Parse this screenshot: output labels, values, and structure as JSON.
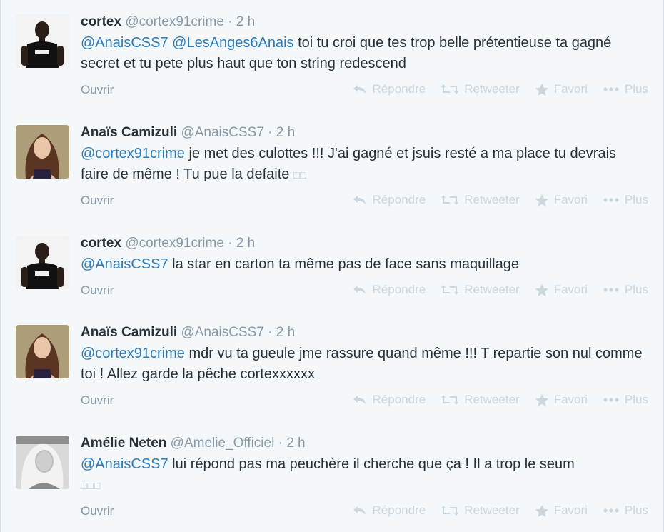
{
  "tweets": [
    {
      "name": "cortex",
      "handle": "@cortex91crime",
      "separator": "·",
      "time": "2 h",
      "mentions": [
        "@AnaisCSS7",
        "@LesAnges6Anais"
      ],
      "text": "toi tu croi que tes trop belle prétentieuse ta gagné secret et tu pete plus haut que ton string redescend",
      "glyph": "",
      "avatar": "man-in-black-shirt"
    },
    {
      "name": "Anaïs Camizuli",
      "handle": "@AnaisCSS7",
      "separator": "·",
      "time": "2 h",
      "mentions": [
        "@cortex91crime"
      ],
      "text": "je met des culottes !!! J'ai gagné et jsuis resté a ma place tu devrais faire de même ! Tu pue la defaite",
      "glyph": "□□",
      "avatar": "woman-brown-hair"
    },
    {
      "name": "cortex",
      "handle": "@cortex91crime",
      "separator": "·",
      "time": "2 h",
      "mentions": [
        "@AnaisCSS7"
      ],
      "text": "la star en carton ta même pas de face sans maquillage",
      "glyph": "",
      "avatar": "man-in-black-shirt"
    },
    {
      "name": "Anaïs Camizuli",
      "handle": "@AnaisCSS7",
      "separator": "·",
      "time": "2 h",
      "mentions": [
        "@cortex91crime"
      ],
      "text": "mdr vu ta gueule jme rassure quand même !!! T repartie son nul comme toi ! Allez garde la pêche cortexxxxxx",
      "glyph": "",
      "avatar": "woman-brown-hair"
    },
    {
      "name": "Amélie Neten",
      "handle": "@Amelie_Officiel",
      "separator": "·",
      "time": "2 h",
      "mentions": [
        "@AnaisCSS7"
      ],
      "text": "lui répond pas ma peuchère il cherche que ça ! Il a trop le seum",
      "glyph": "□□□",
      "avatar": "woman-blonde-bw"
    }
  ],
  "actions": {
    "open": "Ouvrir",
    "reply": "Répondre",
    "retweet": "Retweeter",
    "favorite": "Favori",
    "more": "Plus"
  },
  "colors": {
    "background": "#f5f8fa",
    "mention": "#2b7bb9",
    "muted": "#8899a6",
    "action": "#ccd6dd"
  }
}
